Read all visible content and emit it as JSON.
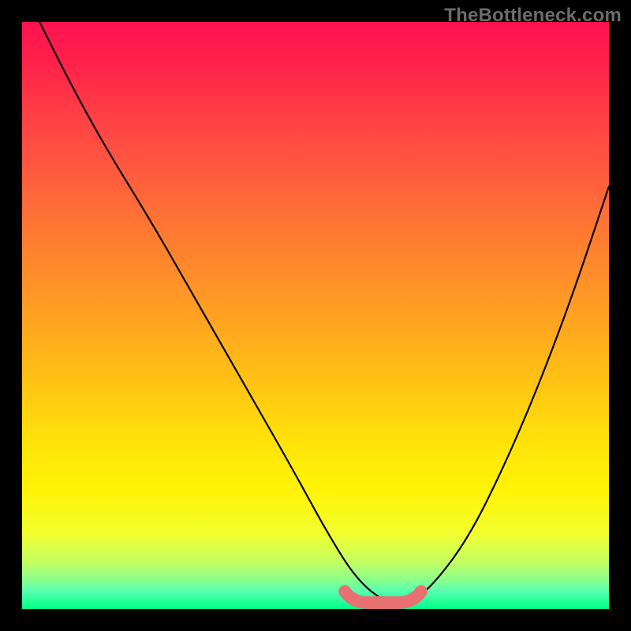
{
  "watermark": "TheBottleneck.com",
  "chart_data": {
    "type": "line",
    "title": "",
    "xlabel": "",
    "ylabel": "",
    "xlim": [
      0,
      100
    ],
    "ylim": [
      0,
      100
    ],
    "grid": false,
    "legend": false,
    "series": [
      {
        "name": "bottleneck-curve",
        "x": [
          3,
          8,
          14,
          22,
          30,
          38,
          46,
          52,
          57,
          62,
          66,
          70,
          76,
          82,
          88,
          94,
          100
        ],
        "y": [
          100,
          90,
          79,
          66,
          52,
          38,
          24,
          13,
          5,
          1,
          1,
          4,
          12,
          24,
          38,
          54,
          72
        ]
      }
    ],
    "annotations": [
      {
        "name": "minimum-marker",
        "type": "highlight",
        "x_range": [
          55,
          68
        ],
        "y": 0,
        "color": "#e97070"
      }
    ],
    "background_gradient": {
      "top": "#ff1251",
      "bottom": "#00ff88",
      "meaning": "high-to-low-bottleneck"
    }
  }
}
